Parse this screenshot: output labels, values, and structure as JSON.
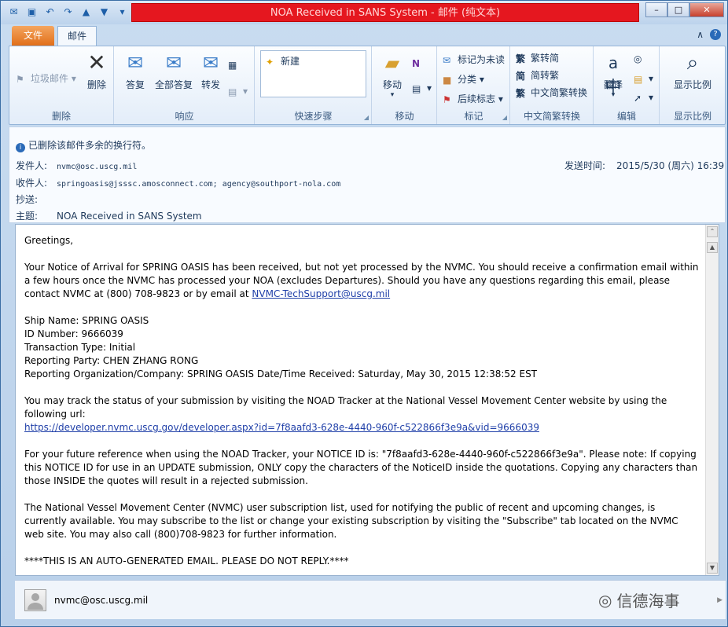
{
  "window": {
    "title": "NOA Received in SANS System  -  邮件 (纯文本)",
    "minimize": "–",
    "maximize": "□",
    "close": "✕"
  },
  "tabs": {
    "file": "文件",
    "mail": "邮件"
  },
  "ribbon": {
    "delete_group": {
      "label": "删除",
      "junk": "垃圾邮件",
      "delete": "删除"
    },
    "respond_group": {
      "label": "响应",
      "reply": "答复",
      "reply_all": "全部答复",
      "forward": "转发"
    },
    "quicksteps_group": {
      "label": "快速步骤",
      "new": "新建"
    },
    "move_group": {
      "label": "移动",
      "move": "移动"
    },
    "tags_group": {
      "label": "标记",
      "mark_unread": "标记为未读",
      "categorize": "分类",
      "follow_up": "后续标志"
    },
    "chinese_group": {
      "label": "中文简繁转换",
      "to_trad": "繁转简",
      "to_simp": "简转繁",
      "convert": "中文简繁转换"
    },
    "edit_group": {
      "label": "编辑",
      "translate": "翻译"
    },
    "zoom_group": {
      "label": "显示比例",
      "zoom": "显示比例"
    }
  },
  "header": {
    "info": "已删除该邮件多余的换行符。",
    "from_label": "发件人:",
    "from": "nvmc@osc.uscg.mil",
    "to_label": "收件人:",
    "to": "springoasis@jsssc.amosconnect.com; agency@southport-nola.com",
    "cc_label": "抄送:",
    "subject_label": "主题:",
    "subject": "NOA Received in SANS System",
    "sent_label": "发送时间:",
    "sent": "2015/5/30 (周六) 16:39"
  },
  "body": {
    "greeting": "Greetings,",
    "p1": "Your Notice of Arrival for SPRING OASIS has been received, but not yet processed by the NVMC.     You should receive a confirmation email within a few hours once the NVMC has processed your NOA (excludes Departures).     Should you have any questions regarding this email, please contact NVMC at (800) 708-9823 or by email at ",
    "p1_link": "NVMC-TechSupport@uscg.mil",
    "ship_name": "Ship Name: SPRING OASIS",
    "id_number": "ID Number: 9666039",
    "transaction": "Transaction Type: Initial",
    "reporting_party": "Reporting Party: CHEN ZHANG RONG",
    "reporting_org": "Reporting Organization/Company: SPRING OASIS Date/Time Received: Saturday, May 30, 2015 12:38:52 EST",
    "p3": "You may track the status of your submission by visiting the NOAD Tracker at the National Vessel Movement Center website by using the following url:",
    "p3_link": "https://developer.nvmc.uscg.gov/developer.aspx?id=7f8aafd3-628e-4440-960f-c522866f3e9a&vid=9666039",
    "p4": "For your future reference when using the NOAD Tracker, your NOTICE ID is:     \"7f8aafd3-628e-4440-960f-c522866f3e9a\".     Please note:     If copying this NOTICE ID for use in an UPDATE submission, ONLY copy the characters of the NoticeID inside the quotations.     Copying any characters than those INSIDE the quotes will result in a rejected submission.",
    "p5": "The National Vessel Movement Center (NVMC) user subscription list, used for notifying the public of recent and upcoming changes, is currently available. You may subscribe to the list or change your existing subscription by visiting the \"Subscribe\" tab located on the NVMC web site. You may also call (800)708-9823 for further information.",
    "p6": "****THIS IS AN AUTO-GENERATED EMAIL.     PLEASE DO NOT REPLY.****"
  },
  "people_pane": {
    "name": "nvmc@osc.uscg.mil",
    "watermark": "信德海事"
  }
}
